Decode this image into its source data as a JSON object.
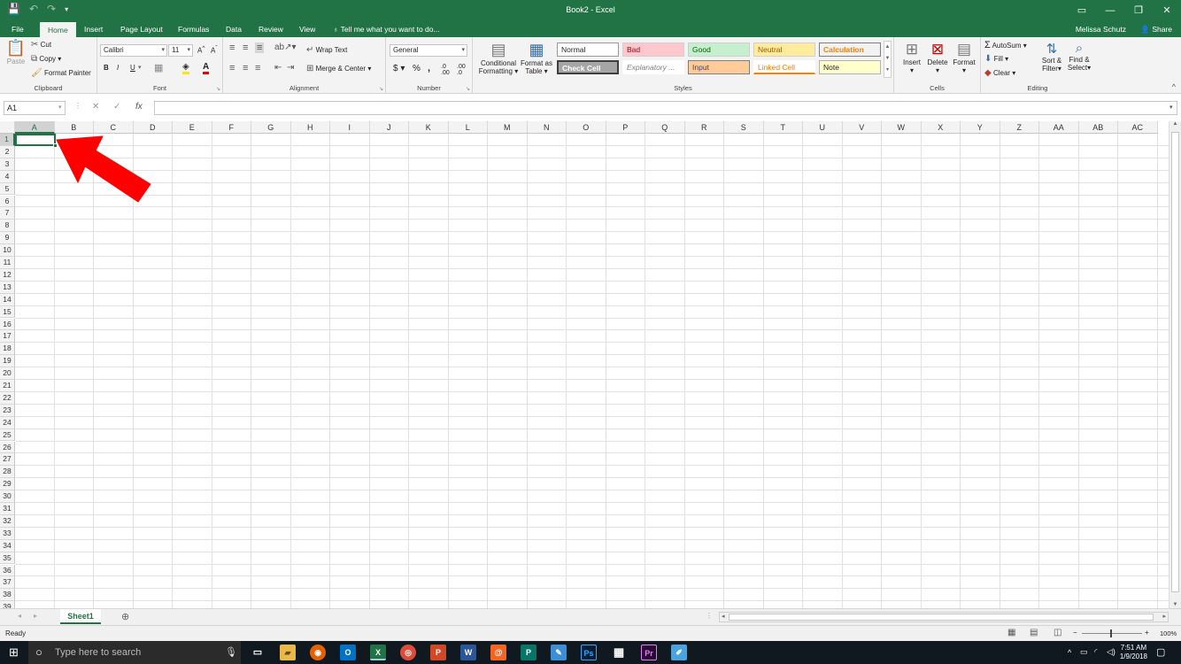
{
  "titlebar": {
    "title": "Book2 - Excel",
    "qat": [
      "save-icon",
      "undo-icon",
      "redo-icon",
      "customize-icon"
    ]
  },
  "tabs": [
    "File",
    "Home",
    "Insert",
    "Page Layout",
    "Formulas",
    "Data",
    "Review",
    "View"
  ],
  "tellme": "Tell me what you want to do...",
  "user": "Melissa Schutz",
  "share": "Share",
  "clipboard": {
    "paste": "Paste",
    "cut": "Cut",
    "copy": "Copy",
    "format_painter": "Format Painter",
    "label": "Clipboard"
  },
  "font": {
    "name": "Calibri",
    "size": "11",
    "label": "Font",
    "bold": "B",
    "italic": "I",
    "underline": "U"
  },
  "alignment": {
    "wrap": "Wrap Text",
    "merge": "Merge & Center",
    "label": "Alignment"
  },
  "number": {
    "format": "General",
    "label": "Number",
    "currency": "$",
    "percent": "%",
    "comma": ","
  },
  "styles": {
    "cond1": "Conditional",
    "cond2": "Formatting",
    "fmt1": "Format as",
    "fmt2": "Table",
    "label": "Styles",
    "items": [
      {
        "label": "Normal"
      },
      {
        "label": "Bad"
      },
      {
        "label": "Good"
      },
      {
        "label": "Neutral"
      },
      {
        "label": "Calculation"
      },
      {
        "label": "Check Cell"
      },
      {
        "label": "Explanatory ..."
      },
      {
        "label": "Input"
      },
      {
        "label": "Linked Cell"
      },
      {
        "label": "Note"
      }
    ]
  },
  "cells": {
    "insert": "Insert",
    "delete": "Delete",
    "format": "Format",
    "label": "Cells"
  },
  "editing": {
    "autosum": "AutoSum",
    "fill": "Fill",
    "clear": "Clear",
    "sort1": "Sort &",
    "sort2": "Filter",
    "find1": "Find &",
    "find2": "Select",
    "label": "Editing"
  },
  "formula_bar": {
    "name_box": "A1",
    "fx": "fx",
    "value": ""
  },
  "columns": [
    "A",
    "B",
    "C",
    "D",
    "E",
    "F",
    "G",
    "H",
    "I",
    "J",
    "K",
    "L",
    "M",
    "N",
    "O",
    "P",
    "Q",
    "R",
    "S",
    "T",
    "U",
    "V",
    "W",
    "X",
    "Y",
    "Z",
    "AA",
    "AB",
    "AC"
  ],
  "rows": [
    "1",
    "2",
    "3",
    "4",
    "5",
    "6",
    "7",
    "8",
    "9",
    "10",
    "11",
    "12",
    "13",
    "14",
    "15",
    "16",
    "17",
    "18",
    "19",
    "20",
    "21",
    "22",
    "23",
    "24",
    "25",
    "26",
    "27",
    "28",
    "29",
    "30",
    "31",
    "32",
    "33",
    "34",
    "35",
    "36",
    "37",
    "38",
    "39"
  ],
  "sheet": {
    "name": "Sheet1"
  },
  "status": {
    "text": "Ready",
    "zoom": "100%"
  },
  "taskbar": {
    "search": "Type here to search",
    "time": "7:51 AM",
    "date": "1/9/2018"
  },
  "colors": {
    "excel_green": "#217346",
    "arrow": "#ff0000"
  }
}
